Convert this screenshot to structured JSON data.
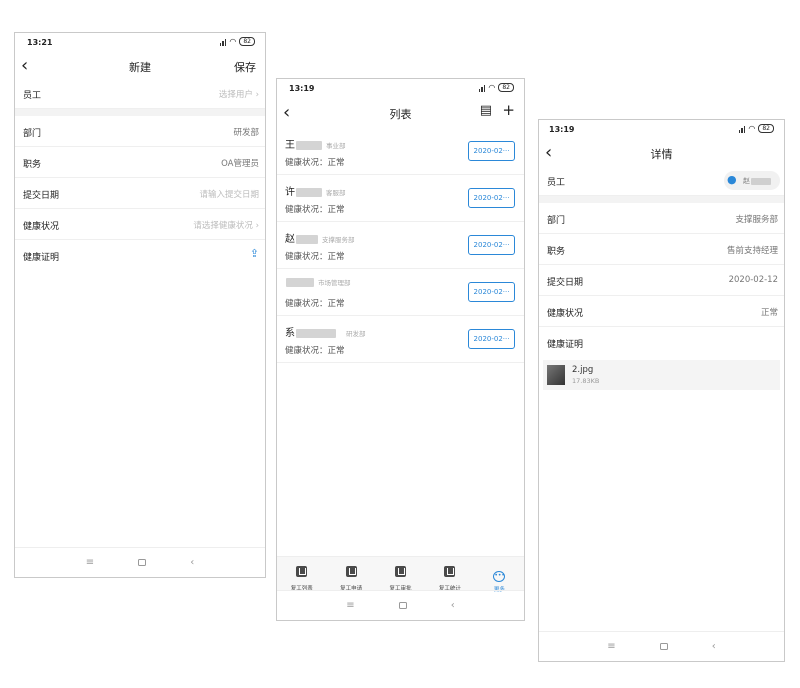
{
  "phone_new": {
    "status_time": "13:21",
    "battery": "82",
    "title": "新建",
    "save_label": "保存",
    "rows": [
      {
        "label": "员工",
        "value": "选择用户"
      },
      {
        "label": "部门",
        "value": "研发部"
      },
      {
        "label": "职务",
        "value": "OA管理员"
      },
      {
        "label": "提交日期",
        "value": "请输入提交日期"
      },
      {
        "label": "健康状况",
        "value": "请选择健康状况"
      },
      {
        "label": "健康证明",
        "value": ""
      }
    ]
  },
  "phone_list": {
    "status_time": "13:19",
    "battery": "82",
    "title": "列表",
    "items": [
      {
        "name": "王",
        "dept": "事业部",
        "health": "健康状况：正常",
        "date": "2020-02···"
      },
      {
        "name": "许",
        "dept": "客服部",
        "health": "健康状况：正常",
        "date": "2020-02···"
      },
      {
        "name": "赵",
        "dept": "支撑服务部",
        "health": "健康状况：正常",
        "date": "2020-02···"
      },
      {
        "name": "",
        "dept": "市场管理部",
        "health": "健康状况：正常",
        "date": "2020-02···"
      },
      {
        "name": "系",
        "dept": "研发部",
        "health": "健康状况：正常",
        "date": "2020-02···"
      }
    ],
    "tabs": [
      "复工列表",
      "复工申请",
      "复工审批",
      "复工统计",
      "更多"
    ]
  },
  "phone_detail": {
    "status_time": "13:19",
    "battery": "82",
    "title": "详情",
    "employee_label": "员工",
    "employee_name": "赵",
    "rows": [
      {
        "label": "部门",
        "value": "支撑服务部"
      },
      {
        "label": "职务",
        "value": "售前支持经理"
      },
      {
        "label": "提交日期",
        "value": "2020-02-12"
      },
      {
        "label": "健康状况",
        "value": "正常"
      },
      {
        "label": "健康证明",
        "value": ""
      }
    ],
    "file": {
      "name": "2.jpg",
      "size": "17.83KB"
    }
  },
  "colors": {
    "accent": "#2b88d8",
    "divider": "#efefef",
    "placeholder": "#bcbcbc"
  },
  "icons": {
    "back": "chevron-left-icon",
    "list": "list-icon",
    "add": "plus-icon",
    "attach": "attach-icon",
    "user": "user-icon"
  }
}
